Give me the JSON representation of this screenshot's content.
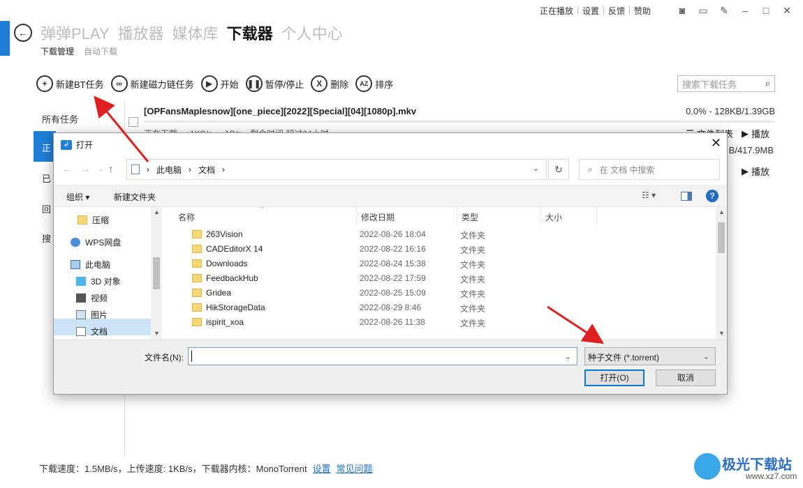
{
  "window_controls": {
    "links": [
      "正在播放",
      "设置",
      "反馈",
      "赞助"
    ],
    "icons": [
      "camera-icon",
      "window-icon",
      "pin-icon",
      "minimize-icon",
      "maximize-icon",
      "close-icon"
    ]
  },
  "nav": {
    "tabs": [
      "弹弹PLAY",
      "播放器",
      "媒体库",
      "下载器",
      "个人中心"
    ],
    "active": "下载器"
  },
  "subnav": {
    "tabs": [
      "下载管理",
      "自动下载"
    ]
  },
  "toolbar": {
    "new_bt": "新建BT任务",
    "new_magnet": "新建磁力链任务",
    "start": "开始",
    "pause": "暂停/停止",
    "delete": "删除",
    "sort": "排序",
    "search_placeholder": "搜索下载任务"
  },
  "left_menu": {
    "all": "所有任务",
    "downloading": "正",
    "done": "已",
    "recycle": "回",
    "search": "搜"
  },
  "task": {
    "name": "[OPFansMaplesnow][one_piece][2022][Special][04][1080p].mkv",
    "progress": "0.0% - 128KB/1.39GB",
    "status": "正在下载，↓1KB/s，↑1B/s，剩余时间 超过24小时",
    "file_list": "文件列表",
    "play": "播放"
  },
  "task2": {
    "size": "B/417.9MB",
    "play": "播放"
  },
  "statusbar": {
    "text": "下载速度：1.5MB/s，上传速度: 1KB/s，下载器内核：MonoTorrent",
    "settings": "设置",
    "faq": "常见问题"
  },
  "watermark": {
    "name": "极光下载站",
    "url": "www.xz7.com"
  },
  "dialog": {
    "title": "打开",
    "path": [
      "此电脑",
      "文档"
    ],
    "search_placeholder": "在 文档 中搜索",
    "organize": "组织 ▾",
    "new_folder": "新建文件夹",
    "tree": [
      "压缩",
      "WPS网盘",
      "此电脑",
      "3D 对象",
      "视频",
      "图片",
      "文档"
    ],
    "columns": [
      "名称",
      "修改日期",
      "类型",
      "大小"
    ],
    "files": [
      {
        "name": "263Vision",
        "date": "2022-08-26 18:04",
        "type": "文件夹"
      },
      {
        "name": "CADEditorX 14",
        "date": "2022-08-22 16:16",
        "type": "文件夹"
      },
      {
        "name": "Downloads",
        "date": "2022-08-24 15:38",
        "type": "文件夹"
      },
      {
        "name": "FeedbackHub",
        "date": "2022-08-22 17:59",
        "type": "文件夹"
      },
      {
        "name": "Gridea",
        "date": "2022-08-25 15:09",
        "type": "文件夹"
      },
      {
        "name": "HikStorageData",
        "date": "2022-08-29 8:46",
        "type": "文件夹"
      },
      {
        "name": "ispirit_xoa",
        "date": "2022-08-26 11:38",
        "type": "文件夹"
      }
    ],
    "filename_label": "文件名(N):",
    "filename_value": "",
    "filetype": "种子文件 (*.torrent)",
    "open_button": "打开(O)",
    "cancel_button": "取消"
  },
  "colors": {
    "accent": "#1e7fd6",
    "annotation_arrow": "#e02020",
    "selected_tree": "#cce4f7"
  }
}
